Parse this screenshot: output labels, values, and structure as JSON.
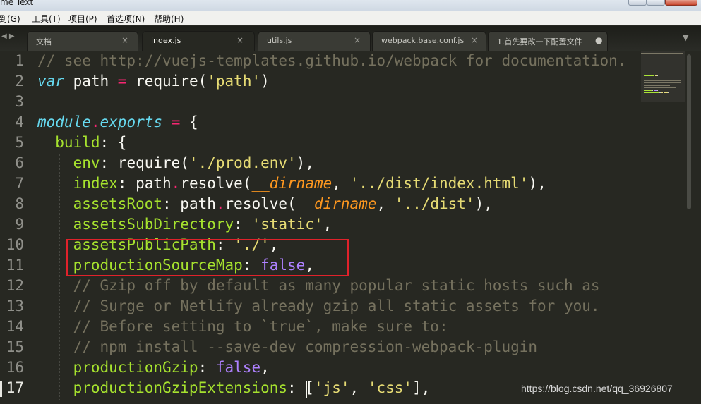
{
  "window": {
    "title_fragment": "me Text"
  },
  "menu": {
    "items": [
      {
        "label": "转到(G)"
      },
      {
        "label": "工具(T)"
      },
      {
        "label": "项目(P)"
      },
      {
        "label": "首选项(N)"
      },
      {
        "label": "帮助(H)"
      }
    ]
  },
  "tabs": {
    "nav_glyph": "◀ ▶",
    "dropdown_glyph": "▼",
    "items": [
      {
        "label": "文档",
        "close": "×",
        "active": false
      },
      {
        "label": "index.js",
        "close": "×",
        "active": true
      },
      {
        "label": "utils.js",
        "close": "×",
        "active": false
      },
      {
        "label": "webpack.base.conf.js",
        "close": "×",
        "active": false
      },
      {
        "label": "1.首先要改一下配置文件",
        "close": "●",
        "active": false
      }
    ]
  },
  "editor": {
    "line_numbers": [
      "1",
      "2",
      "3",
      "4",
      "5",
      "6",
      "7",
      "8",
      "9",
      "10",
      "11",
      "12",
      "13",
      "14",
      "15",
      "16",
      "17"
    ],
    "current_line": "17",
    "lines": [
      [
        {
          "t": "// see http://vuejs-templates.github.io/webpack for documentation.",
          "c": "comment"
        }
      ],
      [
        {
          "t": "var",
          "c": "kw"
        },
        {
          "t": " path ",
          "c": "plain"
        },
        {
          "t": "=",
          "c": "op"
        },
        {
          "t": " require(",
          "c": "plain"
        },
        {
          "t": "'path'",
          "c": "str"
        },
        {
          "t": ")",
          "c": "plain"
        }
      ],
      [],
      [
        {
          "t": "module",
          "c": "kw"
        },
        {
          "t": ".",
          "c": "op"
        },
        {
          "t": "exports",
          "c": "kw"
        },
        {
          "t": " ",
          "c": "plain"
        },
        {
          "t": "=",
          "c": "op"
        },
        {
          "t": " {",
          "c": "plain"
        }
      ],
      [
        {
          "t": "  build",
          "c": "key"
        },
        {
          "t": ": {",
          "c": "plain"
        }
      ],
      [
        {
          "t": "    env",
          "c": "key"
        },
        {
          "t": ": require(",
          "c": "plain"
        },
        {
          "t": "'./prod.env'",
          "c": "str"
        },
        {
          "t": "),",
          "c": "plain"
        }
      ],
      [
        {
          "t": "    index",
          "c": "key"
        },
        {
          "t": ": path",
          "c": "plain"
        },
        {
          "t": ".",
          "c": "op"
        },
        {
          "t": "resolve(",
          "c": "plain"
        },
        {
          "t": "__dirname",
          "c": "param"
        },
        {
          "t": ", ",
          "c": "plain"
        },
        {
          "t": "'../dist/index.html'",
          "c": "str"
        },
        {
          "t": "),",
          "c": "plain"
        }
      ],
      [
        {
          "t": "    assetsRoot",
          "c": "key"
        },
        {
          "t": ": path",
          "c": "plain"
        },
        {
          "t": ".",
          "c": "op"
        },
        {
          "t": "resolve(",
          "c": "plain"
        },
        {
          "t": "__dirname",
          "c": "param"
        },
        {
          "t": ", ",
          "c": "plain"
        },
        {
          "t": "'../dist'",
          "c": "str"
        },
        {
          "t": "),",
          "c": "plain"
        }
      ],
      [
        {
          "t": "    assetsSubDirectory",
          "c": "key"
        },
        {
          "t": ": ",
          "c": "plain"
        },
        {
          "t": "'static'",
          "c": "str"
        },
        {
          "t": ",",
          "c": "plain"
        }
      ],
      [
        {
          "t": "    assetsPublicPath",
          "c": "key"
        },
        {
          "t": ": ",
          "c": "plain"
        },
        {
          "t": "'./'",
          "c": "str"
        },
        {
          "t": ",",
          "c": "plain"
        }
      ],
      [
        {
          "t": "    productionSourceMap",
          "c": "key"
        },
        {
          "t": ": ",
          "c": "plain"
        },
        {
          "t": "false",
          "c": "const"
        },
        {
          "t": ",",
          "c": "plain"
        }
      ],
      [
        {
          "t": "    // Gzip off by default as many popular static hosts such as",
          "c": "comment"
        }
      ],
      [
        {
          "t": "    // Surge or Netlify already gzip all static assets for you.",
          "c": "comment"
        }
      ],
      [
        {
          "t": "    // Before setting to `true`, make sure to:",
          "c": "comment"
        }
      ],
      [
        {
          "t": "    // npm install --save-dev compression-webpack-plugin",
          "c": "comment"
        }
      ],
      [
        {
          "t": "    productionGzip",
          "c": "key"
        },
        {
          "t": ": ",
          "c": "plain"
        },
        {
          "t": "false",
          "c": "const"
        },
        {
          "t": ",",
          "c": "plain"
        }
      ],
      [
        {
          "t": "    productionGzipExtensions",
          "c": "key"
        },
        {
          "t": ": [",
          "c": "plain"
        },
        {
          "t": "'js'",
          "c": "str"
        },
        {
          "t": ", ",
          "c": "plain"
        },
        {
          "t": "'css'",
          "c": "str"
        },
        {
          "t": "],",
          "c": "plain"
        }
      ]
    ]
  },
  "annotation": {
    "color": "#e0222b",
    "lines": [
      "10",
      "11"
    ]
  },
  "watermark": "https://blog.csdn.net/qq_36926807",
  "colors": {
    "background": "#272822",
    "comment": "#75715e",
    "keyword": "#66d9ef",
    "operator": "#f92672",
    "string": "#e6db74",
    "key": "#a6e22e",
    "constant": "#ae81ff",
    "parameter": "#fd971f"
  }
}
